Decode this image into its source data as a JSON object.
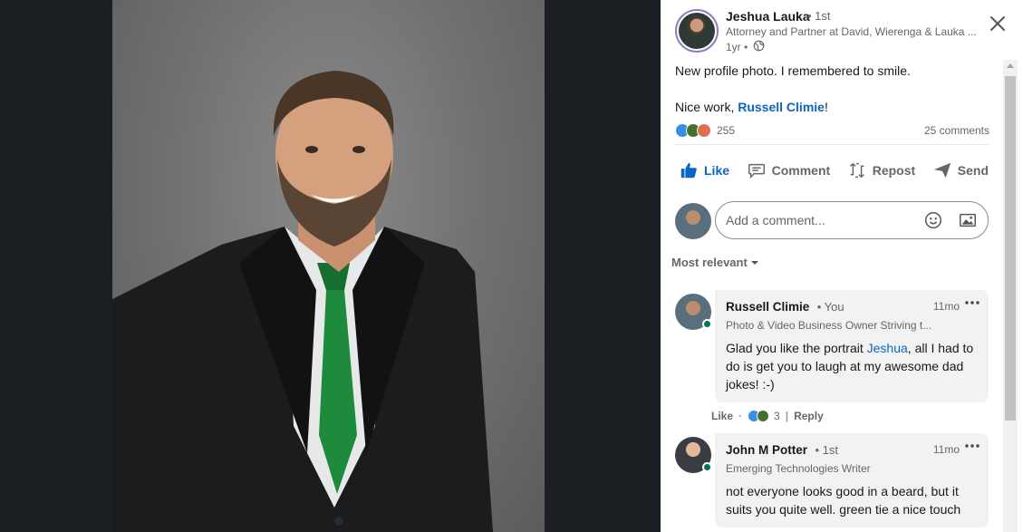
{
  "post": {
    "author_name": "Jeshua Lauka",
    "author_degree": "• 1st",
    "author_headline": "Attorney and Partner at David, Wierenga & Lauka ...",
    "time": "1yr •",
    "text_line1": "New profile photo. I remembered to smile.",
    "text_line2_prefix": "Nice work, ",
    "text_line2_mention": "Russell Climie",
    "text_line2_suffix": "!",
    "reaction_count": "255",
    "comment_count": "25 comments"
  },
  "actions": {
    "like": "Like",
    "comment": "Comment",
    "repost": "Repost",
    "send": "Send"
  },
  "comment_box": {
    "placeholder": "Add a comment..."
  },
  "sort": {
    "label": "Most relevant"
  },
  "comments": [
    {
      "name": "Russell Climie",
      "degree": "• You",
      "time": "11mo",
      "headline": "Photo & Video Business Owner Striving t...",
      "text_prefix": "Glad you like the portrait ",
      "text_mention": "Jeshua",
      "text_suffix": ", all I had to do is get you to laugh at my awesome dad jokes! :-)",
      "like_label": "Like",
      "reaction_count": "3",
      "reply_label": "Reply"
    },
    {
      "name": "John M Potter",
      "degree": "• 1st",
      "time": "11mo",
      "headline": "Emerging Technologies Writer",
      "text": "not everyone looks good in a beard, but it suits you quite well. green tie a nice touch"
    }
  ],
  "colors": {
    "accent": "#0a66c2",
    "online": "#01754f",
    "like_reaction": "#378fe9",
    "celebrate_reaction": "#44712e",
    "love_reaction": "#df704d"
  }
}
